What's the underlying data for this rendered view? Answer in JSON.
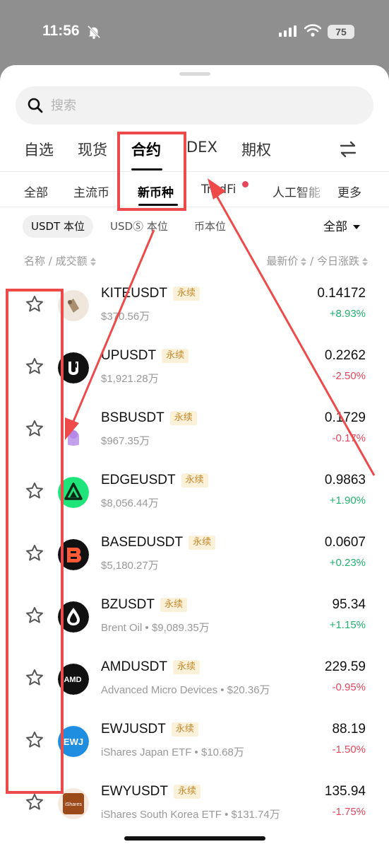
{
  "status_bar": {
    "time": "11:56",
    "battery": "75"
  },
  "search": {
    "placeholder": "搜索"
  },
  "main_tabs": [
    "自选",
    "现货",
    "合约",
    "DEX",
    "期权"
  ],
  "sub_tabs": [
    "全部",
    "主流币",
    "新币种",
    "TradFi",
    "人工智能",
    "更多"
  ],
  "filters": {
    "usdt": "USDT 本位",
    "usdc": "USDⓈ 本位",
    "coin": "币本位",
    "scope": "全部"
  },
  "columns": {
    "name": "名称 / 成交额",
    "price": "最新价",
    "change": "今日涨跌",
    "sep": " / "
  },
  "perp_label": "永续",
  "rows": [
    {
      "symbol": "KITEUSDT",
      "meta": "$370.56万",
      "price": "0.14172",
      "change": "+8.93%",
      "dir": "up",
      "coin_color": "#efe7dc"
    },
    {
      "symbol": "UPUSDT",
      "meta": "$1,921.28万",
      "price": "0.2262",
      "change": "-2.50%",
      "dir": "down",
      "coin_color": "#111111"
    },
    {
      "symbol": "BSBUSDT",
      "meta": "$967.35万",
      "price": "0.1729",
      "change": "-0.17%",
      "dir": "down",
      "coin_color": "#b990e6"
    },
    {
      "symbol": "EDGEUSDT",
      "meta": "$8,056.44万",
      "price": "0.9863",
      "change": "+1.90%",
      "dir": "up",
      "coin_color": "#1fe47a"
    },
    {
      "symbol": "BASEDUSDT",
      "meta": "$5,180.27万",
      "price": "0.0607",
      "change": "+0.23%",
      "dir": "up",
      "coin_color": "#111111"
    },
    {
      "symbol": "BZUSDT",
      "meta": "Brent Oil  •  $9,089.35万",
      "price": "95.34",
      "change": "+1.15%",
      "dir": "up",
      "coin_color": "#111111"
    },
    {
      "symbol": "AMDUSDT",
      "meta": "Advanced Micro Devices  •  $20.36万",
      "price": "229.59",
      "change": "-0.95%",
      "dir": "down",
      "coin_color": "#111111"
    },
    {
      "symbol": "EWJUSDT",
      "meta": "iShares Japan ETF  •  $10.68万",
      "price": "88.19",
      "change": "-1.50%",
      "dir": "down",
      "coin_color": "#1f8ee0"
    },
    {
      "symbol": "EWYUSDT",
      "meta": "iShares South Korea ETF  •  $131.74万",
      "price": "135.94",
      "change": "-1.75%",
      "dir": "down",
      "coin_color": "#9c4a1a"
    }
  ],
  "logo_text": {
    "amd": "AMD",
    "ewj": "EWJ",
    "ewy": "iShares"
  }
}
